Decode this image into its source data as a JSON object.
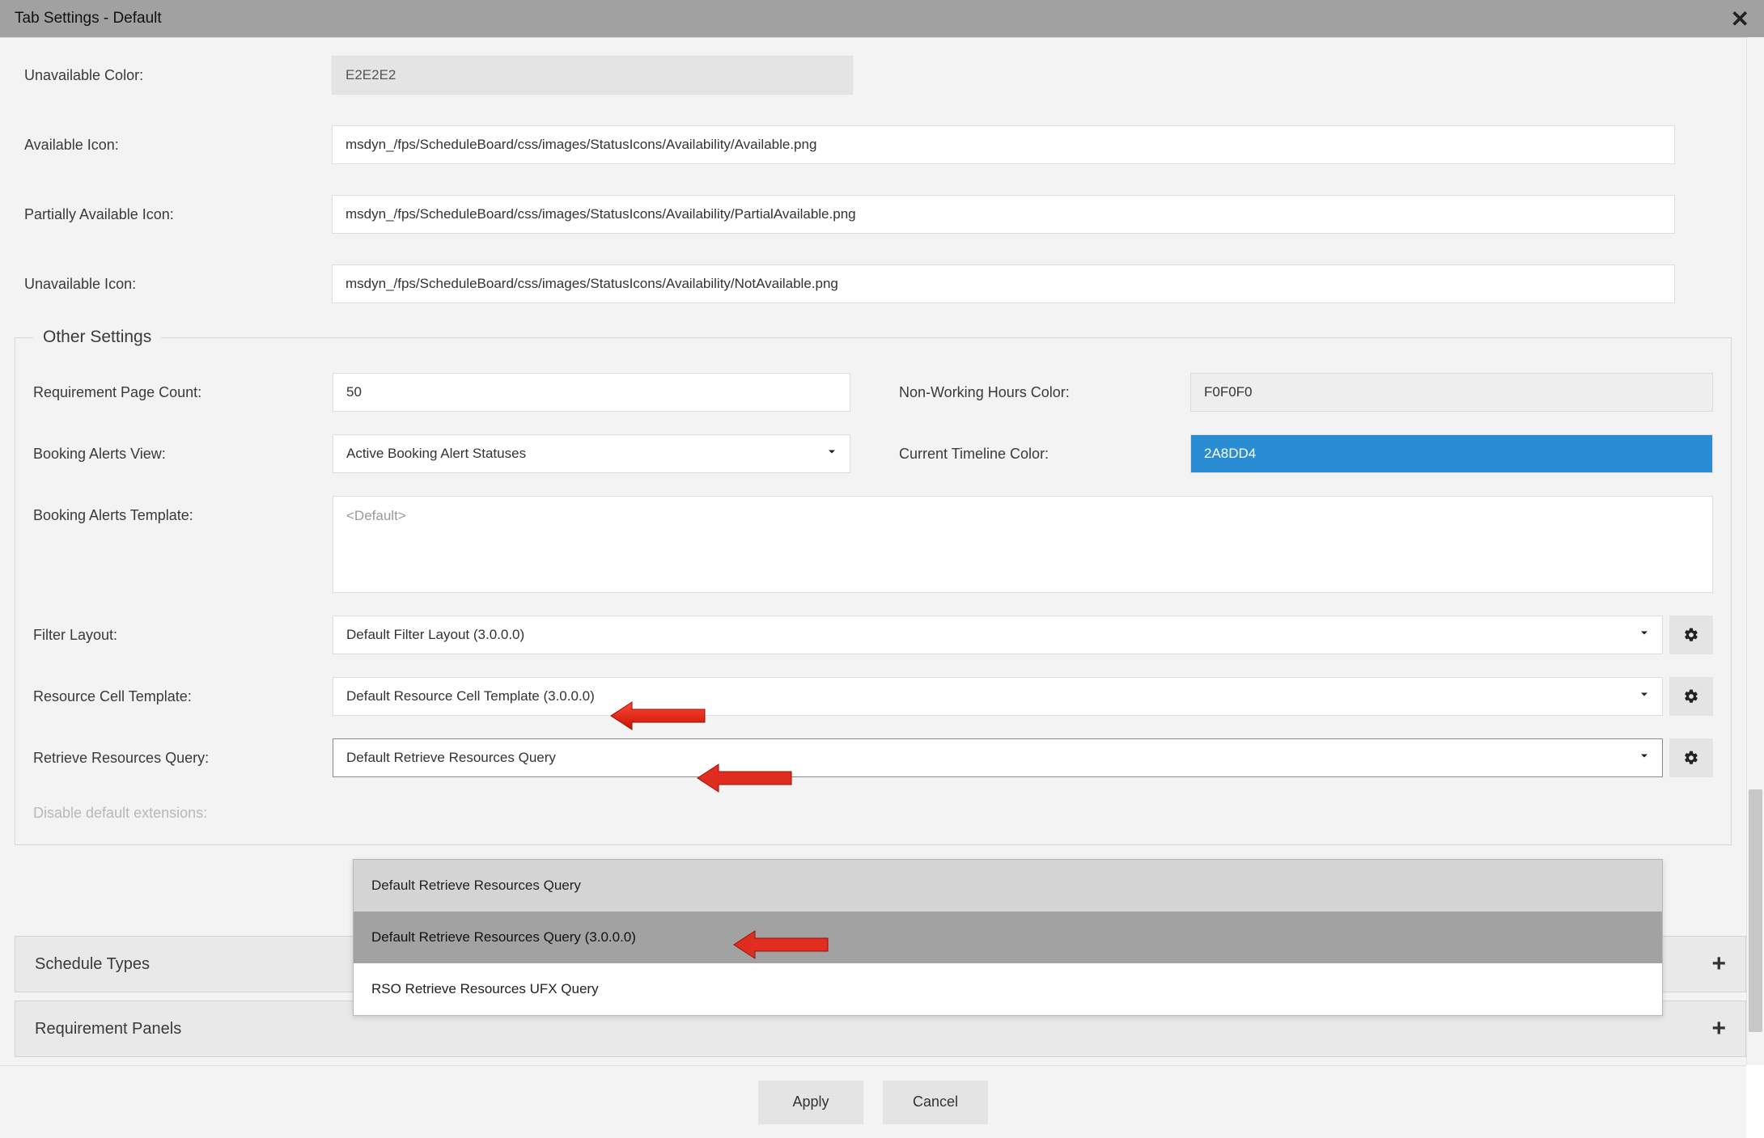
{
  "titlebar": {
    "title": "Tab Settings - Default"
  },
  "top": {
    "unavailable_color_label": "Unavailable Color:",
    "unavailable_color_value": "E2E2E2",
    "available_icon_label": "Available Icon:",
    "available_icon_value": "msdyn_/fps/ScheduleBoard/css/images/StatusIcons/Availability/Available.png",
    "partially_available_icon_label": "Partially Available Icon:",
    "partially_available_icon_value": "msdyn_/fps/ScheduleBoard/css/images/StatusIcons/Availability/PartialAvailable.png",
    "unavailable_icon_label": "Unavailable Icon:",
    "unavailable_icon_value": "msdyn_/fps/ScheduleBoard/css/images/StatusIcons/Availability/NotAvailable.png"
  },
  "other": {
    "legend": "Other Settings",
    "req_page_count_label": "Requirement Page Count:",
    "req_page_count_value": "50",
    "booking_alerts_view_label": "Booking Alerts View:",
    "booking_alerts_view_value": "Active Booking Alert Statuses",
    "booking_alerts_template_label": "Booking Alerts Template:",
    "booking_alerts_template_placeholder": "<Default>",
    "nonworking_color_label": "Non-Working Hours Color:",
    "nonworking_color_value": "F0F0F0",
    "timeline_color_label": "Current Timeline Color:",
    "timeline_color_value": "2A8DD4",
    "filter_layout_label": "Filter Layout:",
    "filter_layout_value": "Default Filter Layout (3.0.0.0)",
    "resource_cell_template_label": "Resource Cell Template:",
    "resource_cell_template_value": "Default Resource Cell Template (3.0.0.0)",
    "retrieve_resources_label": "Retrieve Resources Query:",
    "retrieve_resources_value": "Default Retrieve Resources Query",
    "retrieve_resources_options": [
      "Default Retrieve Resources Query",
      "Default Retrieve Resources Query (3.0.0.0)",
      "RSO Retrieve Resources UFX Query"
    ],
    "disable_ext_label": "Disable default extensions:"
  },
  "accordions": {
    "schedule_types": "Schedule Types",
    "requirement_panels": "Requirement Panels"
  },
  "footer": {
    "apply": "Apply",
    "cancel": "Cancel"
  }
}
